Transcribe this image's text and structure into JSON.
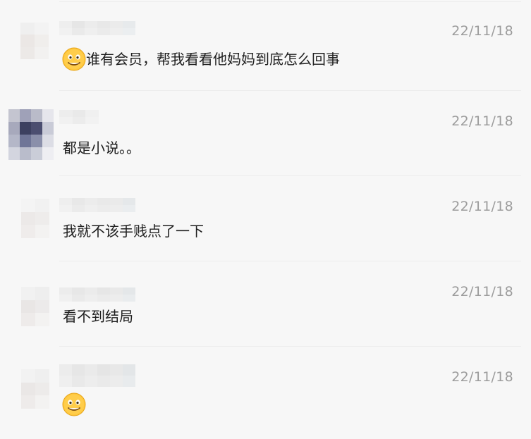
{
  "comments": [
    {
      "timestamp": "22/11/18",
      "has_emoji": true,
      "text": "谁有会员，帮我看看他妈妈到底怎么回事"
    },
    {
      "timestamp": "22/11/18",
      "has_emoji": false,
      "text": "都是小说。。"
    },
    {
      "timestamp": "22/11/18",
      "has_emoji": false,
      "text": "我就不该手贱点了一下"
    },
    {
      "timestamp": "22/11/18",
      "has_emoji": false,
      "text": "看不到结局"
    },
    {
      "timestamp": "22/11/18",
      "has_emoji": true,
      "text": ""
    }
  ],
  "icons": {
    "reaction_emoji": "wry-smile-emoji-icon",
    "avatar": "pixelated-avatar",
    "username": "pixelated-username"
  },
  "colors": {
    "background": "#f7f7f7",
    "timestamp": "#9c9c9c",
    "text": "#1f1f1f",
    "divider": "#ececec",
    "emoji_face": "#ffc83d"
  }
}
